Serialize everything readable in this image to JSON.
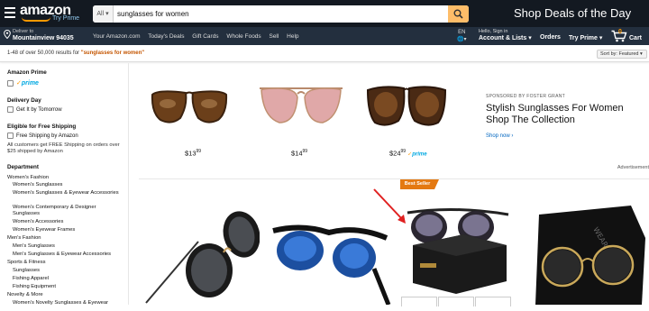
{
  "header": {
    "logo": "amazon",
    "logo_sub": "Try Prime",
    "search": {
      "category": "All",
      "value": "sunglasses for women"
    },
    "promo": "Shop Deals of the Day"
  },
  "nav": {
    "deliver_line1": "Deliver to",
    "deliver_line2": "Mountainview 94035",
    "links": [
      "Your Amazon.com",
      "Today's Deals",
      "Gift Cards",
      "Whole Foods",
      "Sell",
      "Help"
    ],
    "lang": "EN",
    "account_line1": "Hello, Sign in",
    "account_line2": "Account & Lists",
    "orders": "Orders",
    "prime": "Try Prime",
    "cart_count": "0",
    "cart": "Cart"
  },
  "results": {
    "count_text": "1-48 of over 50,000 results for",
    "query": "\"sunglasses for women\"",
    "sort": "Sort by: Featured"
  },
  "sidebar": {
    "amazon_prime_heading": "Amazon Prime",
    "prime_label": "prime",
    "delivery_day_heading": "Delivery Day",
    "get_it_tomorrow": "Get It by Tomorrow",
    "free_shipping_heading": "Eligible for Free Shipping",
    "free_shipping_option": "Free Shipping by Amazon",
    "free_shipping_note": "All customers get FREE Shipping on orders over $25 shipped by Amazon",
    "department_heading": "Department",
    "departments": [
      {
        "label": "Women's Fashion",
        "level": 1
      },
      {
        "label": "Women's Sunglasses",
        "level": 2
      },
      {
        "label": "Women's Sunglasses & Eyewear Accessories",
        "level": 2
      },
      {
        "label": "Women's Contemporary & Designer Sunglasses",
        "level": 2
      },
      {
        "label": "Women's Accessories",
        "level": 2
      },
      {
        "label": "Women's Eyewear Frames",
        "level": 2
      },
      {
        "label": "Men's Fashion",
        "level": 1
      },
      {
        "label": "Men's Sunglasses",
        "level": 2
      },
      {
        "label": "Men's Sunglasses & Eyewear Accessories",
        "level": 2
      },
      {
        "label": "Sports & Fitness",
        "level": 1
      },
      {
        "label": "Sunglasses",
        "level": 2
      },
      {
        "label": "Fishing Apparel",
        "level": 2
      },
      {
        "label": "Fishing Equipment",
        "level": 2
      },
      {
        "label": "Novelty & More",
        "level": 1
      },
      {
        "label": "Women's Novelty Sunglasses & Eyewear",
        "level": 2
      }
    ]
  },
  "sponsored": {
    "products": [
      {
        "dollars": "13",
        "cents": "99",
        "prime": ""
      },
      {
        "dollars": "14",
        "cents": "99",
        "prime": ""
      },
      {
        "dollars": "24",
        "cents": "99",
        "prime": "prime"
      }
    ],
    "label": "SPONSORED BY FOSTER GRANT",
    "title": "Stylish Sunglasses For Women Shop The Collection",
    "link": "Shop now ›",
    "advert": "Advertisement"
  },
  "grid": {
    "badge": "Best Seller"
  },
  "colors": {
    "header_bg": "#131921",
    "nav_bg": "#232f3e",
    "accent": "#febd69",
    "badge": "#e47911",
    "link": "#0066c0",
    "query": "#c45500"
  }
}
